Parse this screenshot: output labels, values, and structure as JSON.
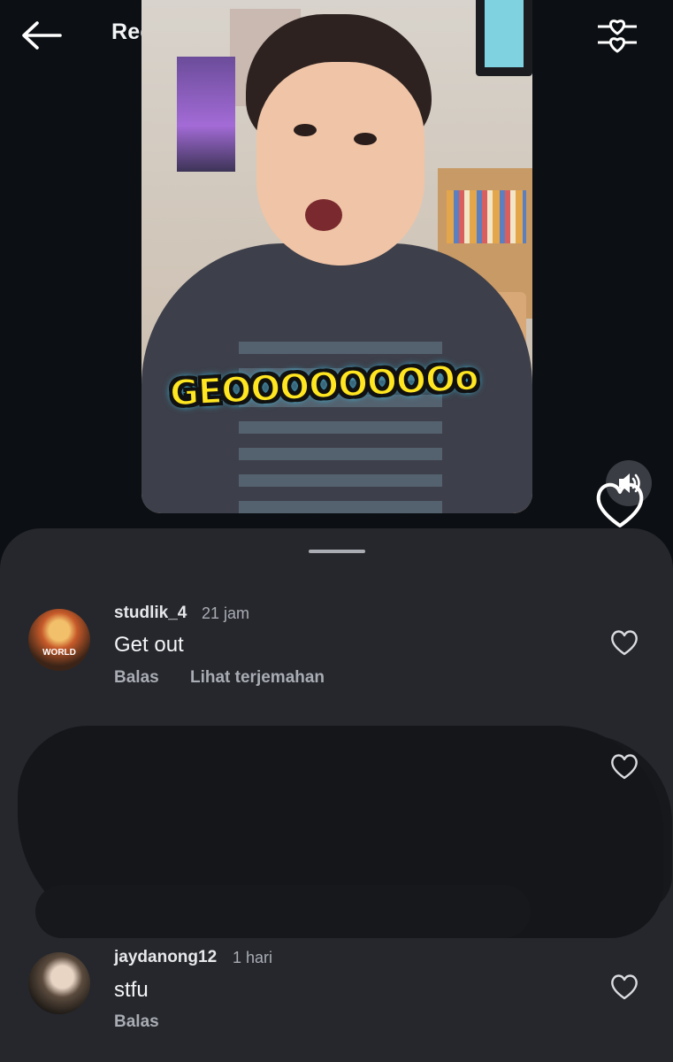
{
  "header": {
    "title": "Reels"
  },
  "video": {
    "caption": "GEOOOOOOOOo"
  },
  "icons": {
    "back": "arrow-left-icon",
    "filter": "heart-slider-filter-icon",
    "volume": "speaker-icon",
    "like": "heart-icon"
  },
  "colors": {
    "background": "#0c0f13",
    "sheet": "#25272d",
    "caption_fill": "#ffe620",
    "muted_text": "#a9adb3"
  },
  "comments": [
    {
      "username": "studlik_4",
      "time": "21 jam",
      "text": "Get out",
      "reply_label": "Balas",
      "translate_label": "Lihat terjemahan",
      "avatar_text": "WORLD"
    },
    {
      "redacted": true
    },
    {
      "username": "jaydanong12",
      "time": "1 hari",
      "text": "stfu",
      "reply_label": "Balas"
    }
  ]
}
